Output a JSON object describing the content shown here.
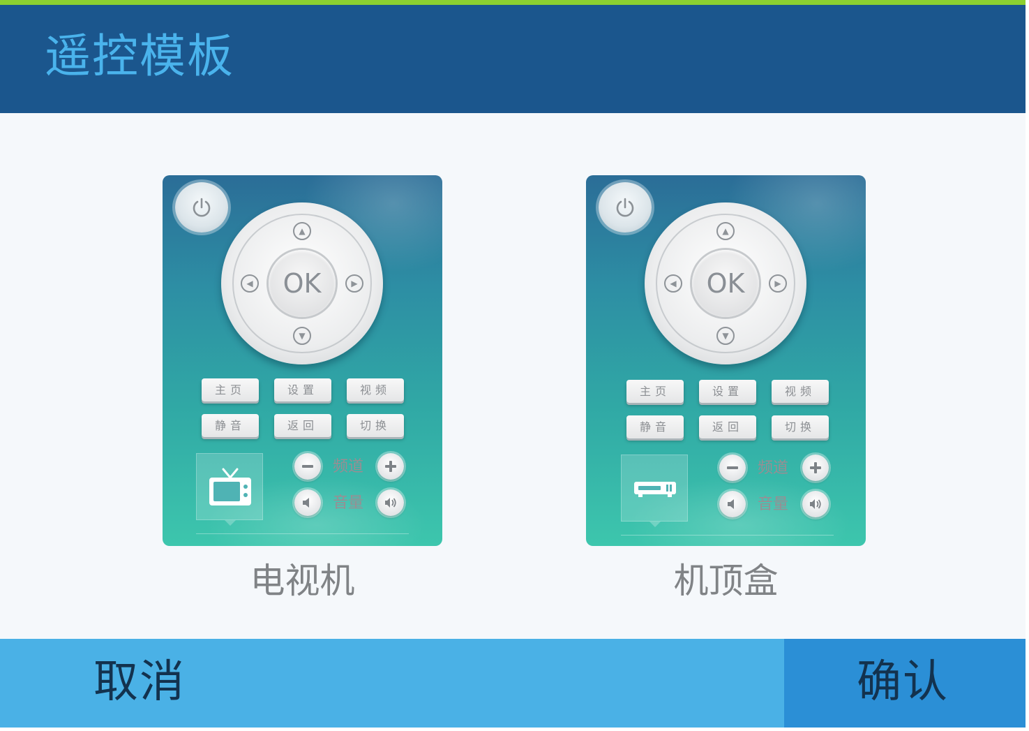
{
  "header": {
    "title": "遥控模板"
  },
  "remotes": [
    {
      "caption": "电视机",
      "device": "tv-icon",
      "ok_label": "OK",
      "buttons": [
        "主页",
        "设置",
        "视频",
        "静音",
        "返回",
        "切换"
      ],
      "channel_label": "频道",
      "volume_label": "音量"
    },
    {
      "caption": "机顶盒",
      "device": "set-top-box-icon",
      "ok_label": "OK",
      "buttons": [
        "主页",
        "设置",
        "视频",
        "静音",
        "返回",
        "切换"
      ],
      "channel_label": "频道",
      "volume_label": "音量"
    }
  ],
  "footer": {
    "cancel_label": "取消",
    "confirm_label": "确认"
  },
  "colors": {
    "header_bg": "#1b568d",
    "title": "#4ab3ec",
    "accent_bar": "#8cd030",
    "cancel_bg": "#4ab1e6",
    "confirm_bg": "#2b8fd6"
  }
}
